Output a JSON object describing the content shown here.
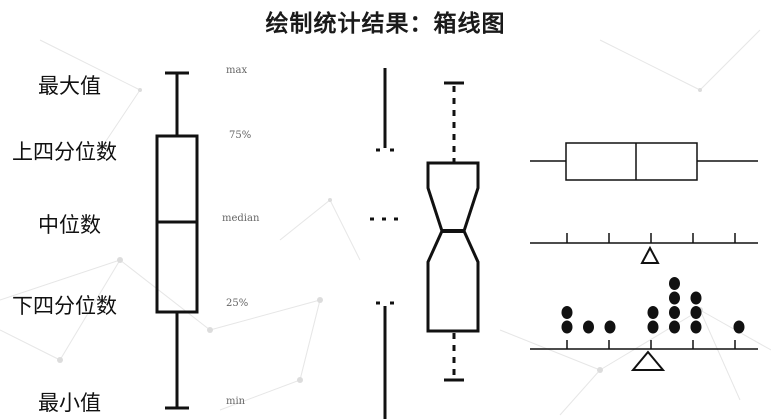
{
  "title": "绘制统计结果：箱线图",
  "labels": {
    "max": "最大值",
    "q3": "上四分位数",
    "median": "中位数",
    "q1": "下四分位数",
    "min": "最小值"
  },
  "annotations": {
    "max": "max",
    "q3": "75%",
    "median": "median",
    "q1": "25%",
    "min": "min"
  },
  "figures": [
    {
      "name": "annotated-boxplot"
    },
    {
      "name": "notched-boxplot-tufte-style"
    },
    {
      "name": "horizontal-boxplot-with-dotplot"
    }
  ],
  "dotplot": {
    "columns": [
      {
        "value": 1,
        "count": 2
      },
      {
        "value": 2,
        "count": 1
      },
      {
        "value": 3,
        "count": 1
      },
      {
        "value": 5,
        "count": 2
      },
      {
        "value": 6,
        "count": 4
      },
      {
        "value": 7,
        "count": 3
      },
      {
        "value": 9,
        "count": 1
      }
    ]
  },
  "colors": {
    "ink": "#111111",
    "network": "#d9d9d9"
  }
}
